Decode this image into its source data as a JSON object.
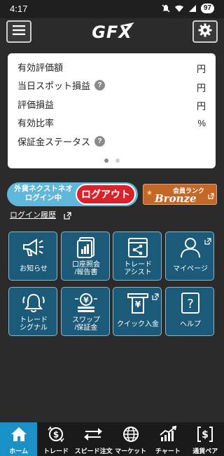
{
  "status_bar": {
    "time": "4:17",
    "battery": "97"
  },
  "header": {
    "logo_text": "GFX"
  },
  "summary": {
    "rows": [
      {
        "label": "有効評価額",
        "unit": "円",
        "help": false
      },
      {
        "label": "当日スポット損益",
        "unit": "円",
        "help": true
      },
      {
        "label": "評価損益",
        "unit": "円",
        "help": false
      },
      {
        "label": "有効比率",
        "unit": "%",
        "help": false
      },
      {
        "label": "保証金ステータス",
        "unit": "",
        "help": true
      }
    ],
    "help_glyph": "?",
    "pages": 2,
    "active_page": 1
  },
  "login": {
    "status_line1": "外貨ネクストネオ",
    "status_line2": "ログイン中",
    "logout_label": "ログアウト",
    "rank_label": "会員ランク",
    "rank_value": "Bronze",
    "history_label": "ログイン履歴"
  },
  "tiles": [
    {
      "line1": "お知らせ",
      "line2": "",
      "icon": "megaphone-icon"
    },
    {
      "line1": "口座照会",
      "line2": "/報告書",
      "icon": "document-icon"
    },
    {
      "line1": "トレード",
      "line2": "アシスト",
      "icon": "share-icon"
    },
    {
      "line1": "マイページ",
      "line2": "",
      "icon": "person-icon"
    },
    {
      "line1": "トレード",
      "line2": "シグナル",
      "icon": "bell-icon"
    },
    {
      "line1": "スワップ",
      "line2": "/保証金",
      "icon": "coins-icon"
    },
    {
      "line1": "クイック入金",
      "line2": "",
      "icon": "yen-deposit-icon"
    },
    {
      "line1": "ヘルプ",
      "line2": "",
      "icon": "help-icon"
    }
  ],
  "help_tile_glyph": "?",
  "bottom_nav": [
    {
      "label": "ホーム",
      "icon": "home-icon",
      "active": true
    },
    {
      "label": "トレード",
      "icon": "trade-icon",
      "active": false
    },
    {
      "label": "スピード注文",
      "icon": "speed-order-icon",
      "active": false
    },
    {
      "label": "マーケット",
      "icon": "globe-icon",
      "active": false
    },
    {
      "label": "チャート",
      "icon": "chart-icon",
      "active": false
    },
    {
      "label": "通貨ペア",
      "icon": "currency-pair-icon",
      "active": false
    }
  ],
  "colors": {
    "background": "#2b2b2b",
    "tile": "#1c5a7a",
    "tile_border": "#8ab4c8",
    "logout": "#d9232c",
    "login_pill": "#5fb7d9",
    "rank": "#c4682a",
    "nav_active": "#1a91c6"
  }
}
